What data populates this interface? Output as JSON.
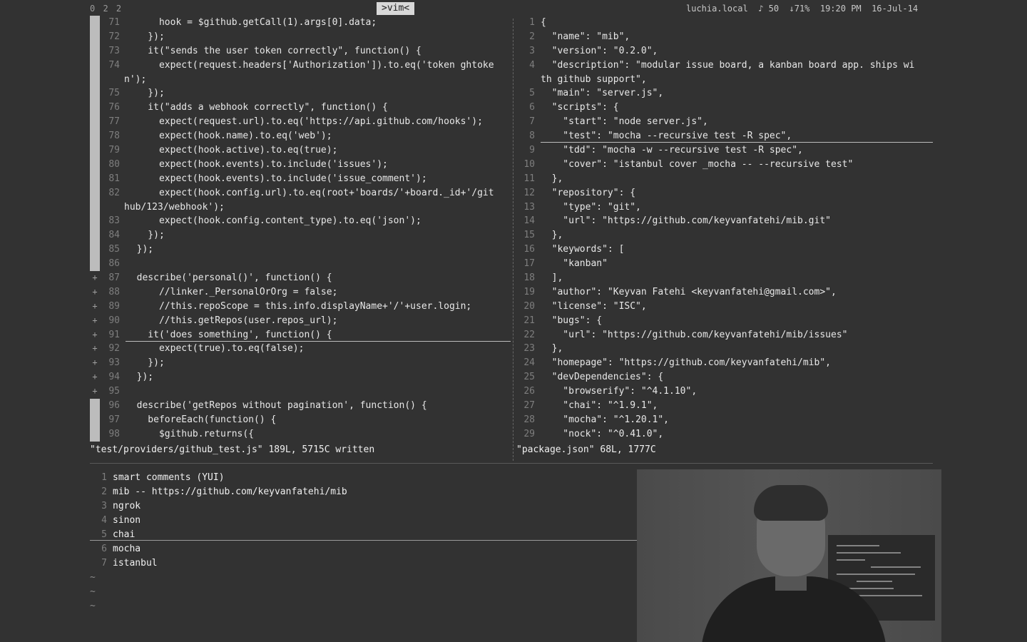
{
  "topbar": {
    "tmux_windows": "0 2 2",
    "tmux_title": ">vim<",
    "status_right": "luchia.local  ♪ 50  ↓71%  19:20 PM  16-Jul-14"
  },
  "left_pane": {
    "lines": [
      {
        "num": "71",
        "sign": "bar",
        "code": "      hook = $github.getCall(1).args[0].data;"
      },
      {
        "num": "72",
        "sign": "bar",
        "code": "    });"
      },
      {
        "num": "73",
        "sign": "bar",
        "code": "    it(\"sends the user token correctly\", function() {"
      },
      {
        "num": "74",
        "sign": "bar",
        "code": "      expect(request.headers['Authorization']).to.eq('token ghtoke"
      },
      {
        "num": "",
        "sign": "bar",
        "code": "n');",
        "wrap": true
      },
      {
        "num": "75",
        "sign": "bar",
        "code": "    });"
      },
      {
        "num": "76",
        "sign": "bar",
        "code": "    it(\"adds a webhook correctly\", function() {"
      },
      {
        "num": "77",
        "sign": "bar",
        "code": "      expect(request.url).to.eq('https://api.github.com/hooks');"
      },
      {
        "num": "78",
        "sign": "bar",
        "code": "      expect(hook.name).to.eq('web');"
      },
      {
        "num": "79",
        "sign": "bar",
        "code": "      expect(hook.active).to.eq(true);"
      },
      {
        "num": "80",
        "sign": "bar",
        "code": "      expect(hook.events).to.include('issues');"
      },
      {
        "num": "81",
        "sign": "bar",
        "code": "      expect(hook.events).to.include('issue_comment');"
      },
      {
        "num": "82",
        "sign": "bar",
        "code": "      expect(hook.config.url).to.eq(root+'boards/'+board._id+'/git"
      },
      {
        "num": "",
        "sign": "bar",
        "code": "hub/123/webhook');",
        "wrap": true
      },
      {
        "num": "83",
        "sign": "bar",
        "code": "      expect(hook.config.content_type).to.eq('json');"
      },
      {
        "num": "84",
        "sign": "bar",
        "code": "    });"
      },
      {
        "num": "85",
        "sign": "bar",
        "code": "  });"
      },
      {
        "num": "86",
        "sign": "bar",
        "code": ""
      },
      {
        "num": "87",
        "sign": "plus",
        "code": "  describe('personal()', function() {"
      },
      {
        "num": "88",
        "sign": "plus",
        "code": "      //linker._PersonalOrOrg = false;"
      },
      {
        "num": "89",
        "sign": "plus",
        "code": "      //this.repoScope = this.info.displayName+'/'+user.login;"
      },
      {
        "num": "90",
        "sign": "plus",
        "code": "      //this.getRepos(user.repos_url);"
      },
      {
        "num": "91",
        "sign": "plus",
        "code": "    it('does something', function() {"
      },
      {
        "num": "92",
        "sign": "plus",
        "code": "      expect(true).to.eq(false);"
      },
      {
        "num": "93",
        "sign": "plus",
        "code": "    });"
      },
      {
        "num": "94",
        "sign": "plus",
        "code": "  });"
      },
      {
        "num": "95",
        "sign": "plus",
        "code": ""
      },
      {
        "num": "96",
        "sign": "bar",
        "code": "  describe('getRepos without pagination', function() {"
      },
      {
        "num": "97",
        "sign": "bar",
        "code": "    beforeEach(function() {"
      },
      {
        "num": "98",
        "sign": "bar",
        "code": "      $github.returns({"
      }
    ],
    "message": "\"test/providers/github_test.js\" 189L, 5715C written"
  },
  "right_pane": {
    "lines": [
      {
        "num": "1",
        "code": "{"
      },
      {
        "num": "2",
        "code": "  \"name\": \"mib\","
      },
      {
        "num": "3",
        "code": "  \"version\": \"0.2.0\","
      },
      {
        "num": "4",
        "code": "  \"description\": \"modular issue board, a kanban board app. ships wi"
      },
      {
        "num": "",
        "code": "th github support\",",
        "wrap": true
      },
      {
        "num": "5",
        "code": "  \"main\": \"server.js\","
      },
      {
        "num": "6",
        "code": "  \"scripts\": {"
      },
      {
        "num": "7",
        "code": "    \"start\": \"node server.js\","
      },
      {
        "num": "8",
        "code": "    \"test\": \"mocha --recursive test -R spec\","
      },
      {
        "num": "9",
        "code": "    \"tdd\": \"mocha -w --recursive test -R spec\","
      },
      {
        "num": "10",
        "code": "    \"cover\": \"istanbul cover _mocha -- --recursive test\""
      },
      {
        "num": "11",
        "code": "  },"
      },
      {
        "num": "12",
        "code": "  \"repository\": {"
      },
      {
        "num": "13",
        "code": "    \"type\": \"git\","
      },
      {
        "num": "14",
        "code": "    \"url\": \"https://github.com/keyvanfatehi/mib.git\""
      },
      {
        "num": "15",
        "code": "  },"
      },
      {
        "num": "16",
        "code": "  \"keywords\": ["
      },
      {
        "num": "17",
        "code": "    \"kanban\""
      },
      {
        "num": "18",
        "code": "  ],"
      },
      {
        "num": "19",
        "code": "  \"author\": \"Keyvan Fatehi <keyvanfatehi@gmail.com>\","
      },
      {
        "num": "20",
        "code": "  \"license\": \"ISC\","
      },
      {
        "num": "21",
        "code": "  \"bugs\": {"
      },
      {
        "num": "22",
        "code": "    \"url\": \"https://github.com/keyvanfatehi/mib/issues\""
      },
      {
        "num": "23",
        "code": "  },"
      },
      {
        "num": "24",
        "code": "  \"homepage\": \"https://github.com/keyvanfatehi/mib\","
      },
      {
        "num": "25",
        "code": "  \"devDependencies\": {"
      },
      {
        "num": "26",
        "code": "    \"browserify\": \"^4.1.10\","
      },
      {
        "num": "27",
        "code": "    \"chai\": \"^1.9.1\","
      },
      {
        "num": "28",
        "code": "    \"mocha\": \"^1.20.1\","
      },
      {
        "num": "29",
        "code": "    \"nock\": \"^0.41.0\","
      }
    ],
    "message": "\"package.json\" 68L, 1777C"
  },
  "notes_pane": {
    "lines": [
      {
        "num": "1",
        "text": "smart comments (YUI)"
      },
      {
        "num": "2",
        "text": "mib -- https://github.com/keyvanfatehi/mib"
      },
      {
        "num": "3",
        "text": "ngrok"
      },
      {
        "num": "4",
        "text": "sinon"
      },
      {
        "num": "5",
        "text": "chai"
      },
      {
        "num": "6",
        "text": "mocha"
      },
      {
        "num": "7",
        "text": "istanbul"
      }
    ],
    "empty_marker": "~"
  },
  "colors": {
    "background": "#323232",
    "text": "#e6e6e6",
    "string": "#9a9a9a",
    "line_number": "#7e7e7e"
  }
}
